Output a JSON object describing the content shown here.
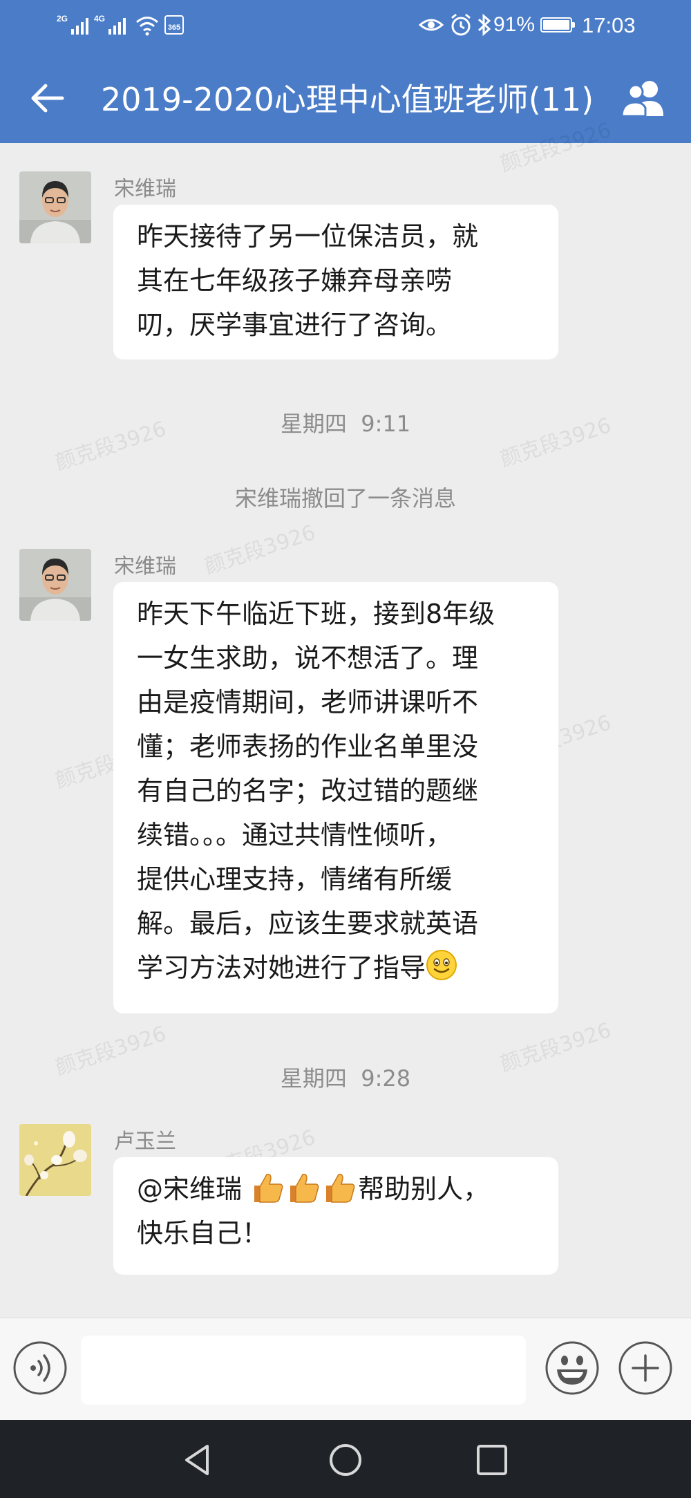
{
  "status_bar": {
    "network_1": "2G",
    "network_2": "4G",
    "calendar_badge": "365",
    "battery": "91%",
    "battery_level": 0.91,
    "time": "17:03"
  },
  "header": {
    "title": "2019-2020心理中心值班老师(11)",
    "back_icon": "arrow-left-icon",
    "members_icon": "people-icon"
  },
  "watermark": "颜克段3926",
  "messages": [
    {
      "sender": "宋维瑞",
      "lines": [
        "昨天接待了另一位保洁员，就",
        "其在七年级孩子嫌弃母亲唠",
        "叨，厌学事宜进行了咨询。"
      ]
    },
    {
      "system_time": "星期四  9:11"
    },
    {
      "system_notice": "宋维瑞撤回了一条消息"
    },
    {
      "sender": "宋维瑞",
      "lines": [
        "昨天下午临近下班，接到8年级",
        "一女生求助，说不想活了。理",
        "由是疫情期间，老师讲课听不",
        "懂；老师表扬的作业名单里没",
        "有自己的名字；改过错的题继",
        "续错。。。通过共情性倾听，",
        "提供心理支持，情绪有所缓",
        "解。最后，应该生要求就英语",
        "学习方法对她进行了指导"
      ],
      "trailing_emoji": "smile-emoji"
    },
    {
      "system_time": "星期四  9:28"
    },
    {
      "sender": "卢玉兰",
      "line1_prefix": "@宋维瑞 ",
      "line1_suffix": "帮助别人，",
      "line2": "快乐自己！",
      "emojis": [
        "thumbs-up-emoji",
        "thumbs-up-emoji",
        "thumbs-up-emoji"
      ]
    }
  ],
  "input_bar": {
    "voice_icon": "voice-icon",
    "input_placeholder": "",
    "emoji_icon": "emoji-icon",
    "plus_icon": "plus-icon"
  },
  "nav_bar": {
    "back": "triangle-back-icon",
    "home": "circle-home-icon",
    "recents": "square-recents-icon"
  }
}
